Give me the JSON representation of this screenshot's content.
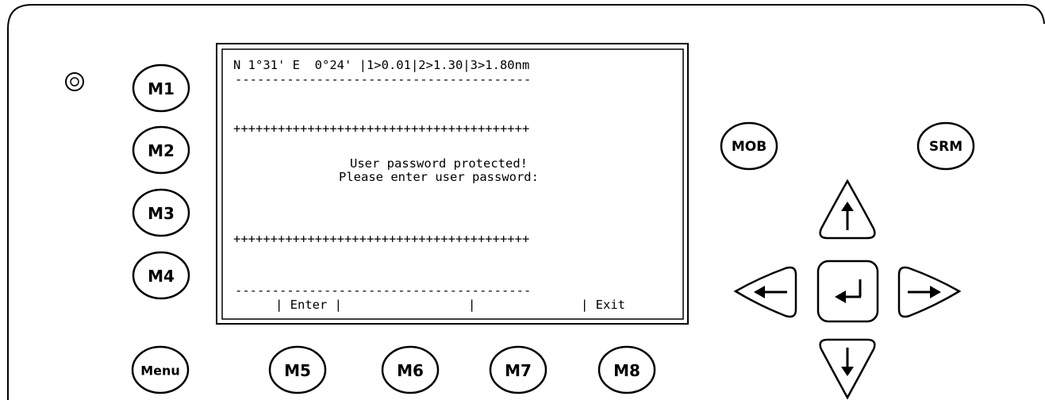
{
  "screen": {
    "status_line": "N 1°31' E  0°24' |1>0.01|2>1.30|3>1.80nm",
    "separator": "----------------------------------------",
    "plus_rule": "++++++++++++++++++++++++++++++++++++++++",
    "message_line1": "User password protected!",
    "message_line2": "Please enter user password:",
    "softkey_enter": "| Enter |",
    "softkey_blank": "|",
    "softkey_exit": "| Exit"
  },
  "buttons": {
    "m1": "M1",
    "m2": "M2",
    "m3": "M3",
    "m4": "M4",
    "menu": "Menu",
    "m5": "M5",
    "m6": "M6",
    "m7": "M7",
    "m8": "M8",
    "mob": "MOB",
    "srm": "SRM"
  },
  "icons": {
    "up": "arrow-up-icon",
    "down": "arrow-down-icon",
    "left": "arrow-left-icon",
    "right": "arrow-right-icon",
    "enter": "enter-icon",
    "indicator": "power-led-icon"
  }
}
